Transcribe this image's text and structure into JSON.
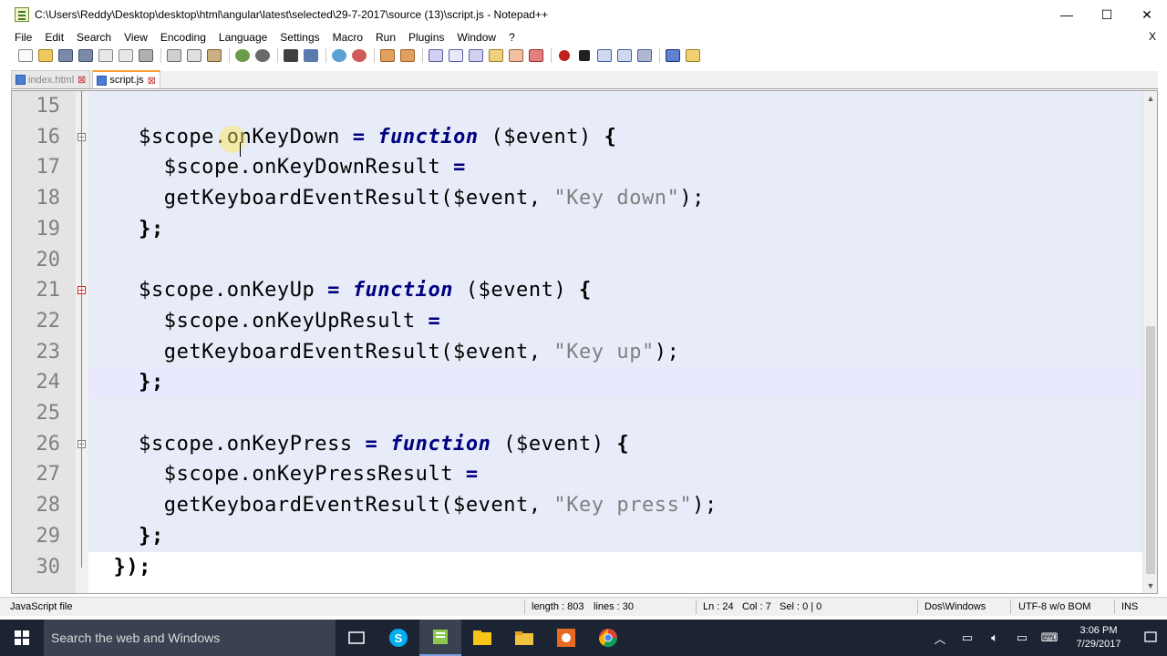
{
  "window": {
    "title": "C:\\Users\\Reddy\\Desktop\\desktop\\html\\angular\\latest\\selected\\29-7-2017\\source (13)\\script.js - Notepad++",
    "minimize_glyph": "—",
    "maximize_glyph": "☐",
    "close_glyph": "✕"
  },
  "menu": {
    "items": [
      "File",
      "Edit",
      "Search",
      "View",
      "Encoding",
      "Language",
      "Settings",
      "Macro",
      "Run",
      "Plugins",
      "Window",
      "?"
    ],
    "close_label": "X"
  },
  "tabs": [
    {
      "label": "index.html",
      "active": false
    },
    {
      "label": "script.js",
      "active": true
    }
  ],
  "editor": {
    "current_line": 24,
    "lines": [
      {
        "num": "15",
        "tokens": []
      },
      {
        "num": "16",
        "tokens": [
          [
            "var",
            "    $scope.onKeyDown "
          ],
          [
            "op",
            "="
          ],
          [
            "var",
            " "
          ],
          [
            "kw",
            "function"
          ],
          [
            "var",
            " ($event) "
          ],
          [
            "punct",
            "{"
          ]
        ]
      },
      {
        "num": "17",
        "tokens": [
          [
            "var",
            "      $scope.onKeyDownResult "
          ],
          [
            "op",
            "="
          ]
        ]
      },
      {
        "num": "18",
        "tokens": [
          [
            "var",
            "      getKeyboardEventResult($event, "
          ],
          [
            "str",
            "\"Key down\""
          ],
          [
            "var",
            ");"
          ]
        ]
      },
      {
        "num": "19",
        "tokens": [
          [
            "punct",
            "    };"
          ]
        ]
      },
      {
        "num": "20",
        "tokens": []
      },
      {
        "num": "21",
        "tokens": [
          [
            "var",
            "    $scope.onKeyUp "
          ],
          [
            "op",
            "="
          ],
          [
            "var",
            " "
          ],
          [
            "kw",
            "function"
          ],
          [
            "var",
            " ($event) "
          ],
          [
            "punct",
            "{"
          ]
        ]
      },
      {
        "num": "22",
        "tokens": [
          [
            "var",
            "      $scope.onKeyUpResult "
          ],
          [
            "op",
            "="
          ]
        ]
      },
      {
        "num": "23",
        "tokens": [
          [
            "var",
            "      getKeyboardEventResult($event, "
          ],
          [
            "str",
            "\"Key up\""
          ],
          [
            "var",
            ");"
          ]
        ]
      },
      {
        "num": "24",
        "tokens": [
          [
            "punct",
            "    };"
          ]
        ]
      },
      {
        "num": "25",
        "tokens": []
      },
      {
        "num": "26",
        "tokens": [
          [
            "var",
            "    $scope.onKeyPress "
          ],
          [
            "op",
            "="
          ],
          [
            "var",
            " "
          ],
          [
            "kw",
            "function"
          ],
          [
            "var",
            " ($event) "
          ],
          [
            "punct",
            "{"
          ]
        ]
      },
      {
        "num": "27",
        "tokens": [
          [
            "var",
            "      $scope.onKeyPressResult "
          ],
          [
            "op",
            "="
          ]
        ]
      },
      {
        "num": "28",
        "tokens": [
          [
            "var",
            "      getKeyboardEventResult($event, "
          ],
          [
            "str",
            "\"Key press\""
          ],
          [
            "var",
            ");"
          ]
        ]
      },
      {
        "num": "29",
        "tokens": [
          [
            "punct",
            "    };"
          ]
        ]
      },
      {
        "num": "30",
        "tokens": [
          [
            "punct",
            "  });"
          ]
        ]
      }
    ]
  },
  "statusbar": {
    "file_type": "JavaScript file",
    "length": "length : 803",
    "lines": "lines : 30",
    "ln": "Ln : 24",
    "col": "Col : 7",
    "sel": "Sel : 0 | 0",
    "eol": "Dos\\Windows",
    "encoding": "UTF-8 w/o BOM",
    "mode": "INS"
  },
  "taskbar": {
    "search_placeholder": "Search the web and Windows",
    "time": "3:06 PM",
    "date": "7/29/2017"
  },
  "colors": {
    "keyword": "#000080",
    "string": "#808080",
    "line_number": "#808080",
    "code_bg": "#e7ecf8",
    "current_line_bg": "#e8e8ff",
    "taskbar_bg": "#1c2433"
  }
}
